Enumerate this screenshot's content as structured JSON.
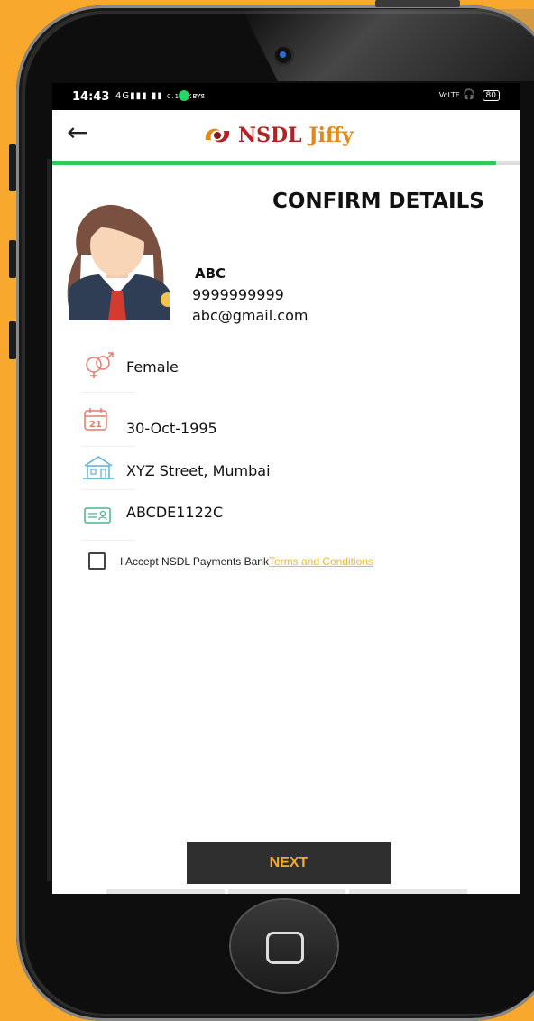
{
  "status_bar": {
    "time": "14:43",
    "signal_text": "4G",
    "network_speed": "0.15 KB/S",
    "more": "···",
    "volte": "VoLTE",
    "battery": "80"
  },
  "app": {
    "back_icon": "arrow-left-icon",
    "brand": "NSDL",
    "brand_suffix": "Jiffy",
    "progress": 0.95
  },
  "page": {
    "title": "CONFIRM DETAILS"
  },
  "user": {
    "name": "ABC",
    "phone": "9999999999",
    "email": "abc@gmail.com"
  },
  "details": {
    "gender": "Female",
    "dob": "30-Oct-1995",
    "dob_icon_day": "21",
    "address": "XYZ Street, Mumbai",
    "pan": "ABCDE1122C"
  },
  "consent": {
    "label": "I Accept NSDL Payments Bank",
    "link": "Terms and Conditions"
  },
  "actions": {
    "next": "NEXT"
  },
  "colors": {
    "background": "#F9A82E",
    "progress": "#35C759",
    "link": "#F4B731",
    "button_bg": "#2f2f2f",
    "button_text": "#F7A928"
  }
}
